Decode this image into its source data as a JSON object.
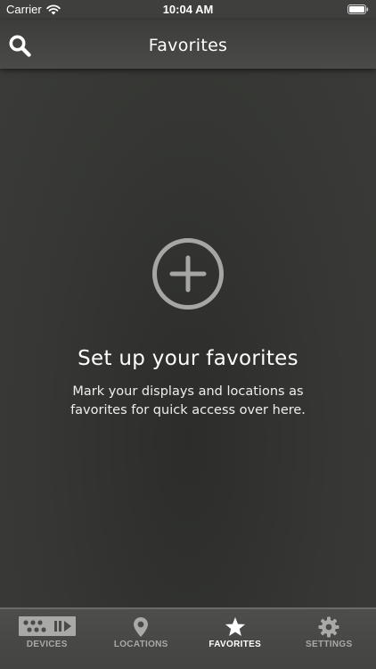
{
  "status_bar": {
    "carrier": "Carrier",
    "time": "10:04 AM"
  },
  "nav": {
    "title": "Favorites"
  },
  "empty_state": {
    "title": "Set up your favorites",
    "description": "Mark your displays and locations as favorites for quick access over here."
  },
  "tabs": [
    {
      "label": "DEVICES",
      "icon": "devices-icon",
      "active": false
    },
    {
      "label": "LOCATIONS",
      "icon": "location-pin-icon",
      "active": false
    },
    {
      "label": "FAVORITES",
      "icon": "star-icon",
      "active": true
    },
    {
      "label": "SETTINGS",
      "icon": "gear-icon",
      "active": false
    }
  ],
  "colors": {
    "background": "#363734",
    "nav_bar": "#444543",
    "active_tab": "#ffffff",
    "inactive_tab": "#a9aaa8"
  }
}
